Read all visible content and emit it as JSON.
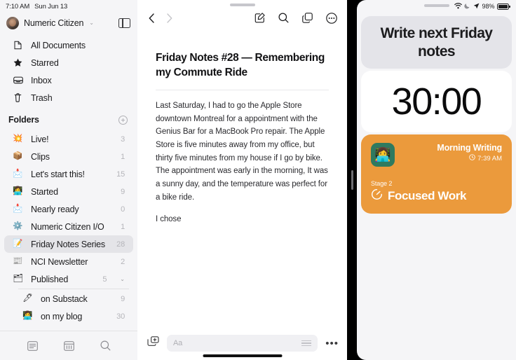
{
  "status_bar": {
    "time": "7:10 AM",
    "date": "Sun Jun 13"
  },
  "sidebar": {
    "account": {
      "name": "Numeric Citizen",
      "chevron": "⌄"
    },
    "nav": [
      {
        "label": "All Documents",
        "icon": "document-icon"
      },
      {
        "label": "Starred",
        "icon": "star-icon"
      },
      {
        "label": "Inbox",
        "icon": "inbox-icon"
      },
      {
        "label": "Trash",
        "icon": "trash-icon"
      }
    ],
    "folders_header": "Folders",
    "folders": [
      {
        "emoji": "💥",
        "label": "Live!",
        "count": "3",
        "selected": false,
        "indent": false
      },
      {
        "emoji": "📦",
        "label": "Clips",
        "count": "1",
        "selected": false,
        "indent": false
      },
      {
        "emoji": "📩",
        "label": "Let's start this!",
        "count": "15",
        "selected": false,
        "indent": false
      },
      {
        "emoji": "👩‍💻",
        "label": "Started",
        "count": "9",
        "selected": false,
        "indent": false
      },
      {
        "emoji": "📩",
        "label": "Nearly ready",
        "count": "0",
        "selected": false,
        "indent": false
      },
      {
        "emoji": "⚙️",
        "label": "Numeric Citizen I/O",
        "count": "1",
        "selected": false,
        "indent": false
      },
      {
        "emoji": "📝",
        "label": "Friday Notes Series",
        "count": "28",
        "selected": true,
        "indent": false
      },
      {
        "emoji": "📰",
        "label": "NCI Newsletter",
        "count": "2",
        "selected": false,
        "indent": false
      },
      {
        "emoji": "🗂",
        "label": "Published",
        "count": "5",
        "selected": false,
        "indent": false,
        "expander": "⌄"
      },
      {
        "emoji": "🖊",
        "label": "on Substack",
        "count": "9",
        "selected": false,
        "indent": true
      },
      {
        "emoji": "👩‍💻",
        "label": "on my blog",
        "count": "30",
        "selected": false,
        "indent": true
      }
    ],
    "bottom_bar": [
      {
        "icon": "list-view-icon"
      },
      {
        "icon": "calendar-icon"
      },
      {
        "icon": "search-icon"
      }
    ]
  },
  "document": {
    "toolbar": {
      "back": "‹",
      "forward": "›",
      "compose": "compose-icon",
      "search": "search-icon",
      "duplicate": "duplicate-icon",
      "more": "more-circle-icon"
    },
    "title": "Friday Notes #28 — Remembering my Commute Ride",
    "paragraphs": [
      "Last Saturday, I had to go the Apple Store downtown Montreal for a appointment with the Genius Bar for a MacBook Pro repair. The Apple Store is five minutes away from my office, but thirty five minutes from my house if I go by bike. The appointment was early in the morning, It was a sunny day, and the temperature was perfect for a bike ride.",
      "I chose"
    ],
    "bottom_bar": {
      "attach_icon": "add-media-icon",
      "format_placeholder": "Aa",
      "more_label": "•••"
    }
  },
  "slide_over": {
    "status": {
      "wifi_icon": "wifi-icon",
      "dnd_icon": "moon-icon",
      "location_icon": "location-arrow-icon",
      "battery_percent": "98%"
    },
    "task_card": {
      "title": "Write next Friday notes",
      "bg_color": "#e4e4e9"
    },
    "timer_card": {
      "time": "30:00",
      "bg_color": "#ffffff"
    },
    "stage_card": {
      "app_emoji": "👩‍💻",
      "session_name": "Morning Writing",
      "session_time": "7:39 AM",
      "clock_icon": "clock-icon",
      "stage_label": "Stage 2",
      "stage_name": "Focused Work",
      "stage_icon": "timer-icon",
      "bg_color": "#eb9a3c"
    }
  }
}
